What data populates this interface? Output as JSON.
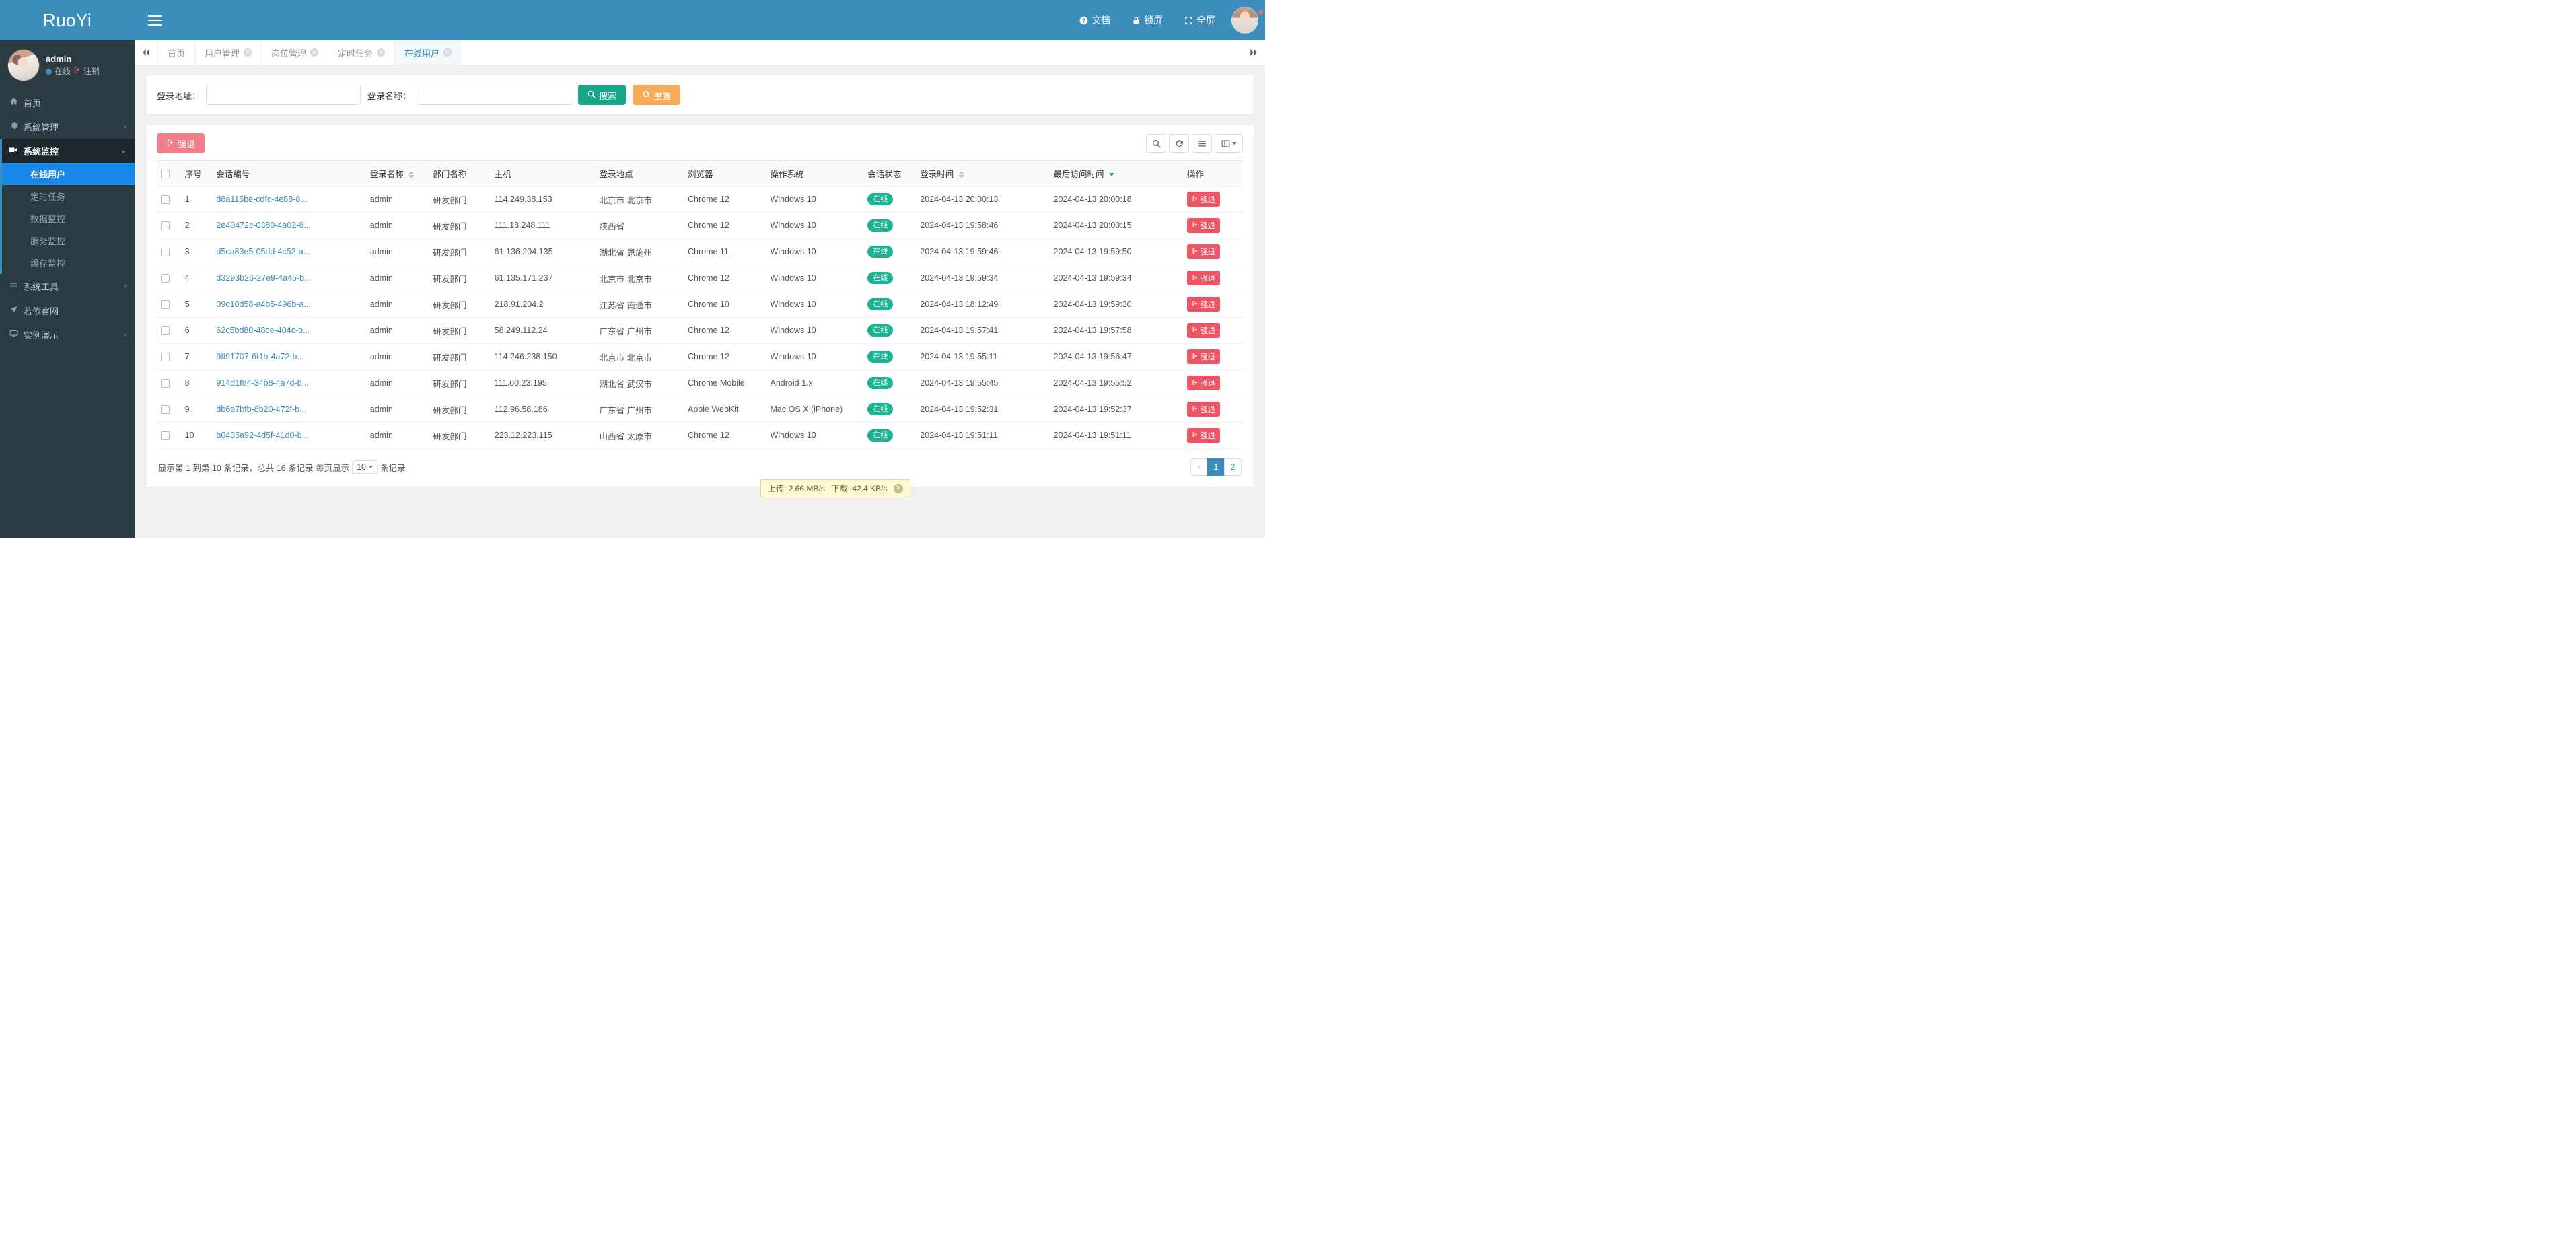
{
  "brand": {
    "title": "RuoYi"
  },
  "navbar": {
    "hamburger_icon": "hamburger-icon",
    "links": [
      {
        "label": "文档",
        "icon": "question-circle-icon",
        "name": "nav-docs"
      },
      {
        "label": "锁屏",
        "icon": "lock-icon",
        "name": "nav-lockscreen"
      },
      {
        "label": "全屏",
        "icon": "expand-arrows-icon",
        "name": "nav-fullscreen"
      }
    ]
  },
  "sidebar": {
    "user": {
      "name": "admin",
      "status": "在线",
      "logout": "注销"
    },
    "menu": [
      {
        "label": "首页",
        "icon": "home-icon",
        "arrow": "",
        "type": "link"
      },
      {
        "label": "系统管理",
        "icon": "gear-icon",
        "arrow": "‹",
        "type": "group"
      },
      {
        "label": "系统监控",
        "icon": "video-camera-icon",
        "arrow": "⌄",
        "type": "group",
        "open": true,
        "children": [
          {
            "label": "在线用户",
            "active": true
          },
          {
            "label": "定时任务",
            "active": false
          },
          {
            "label": "数据监控",
            "active": false
          },
          {
            "label": "服务监控",
            "active": false
          },
          {
            "label": "缓存监控",
            "active": false
          }
        ]
      },
      {
        "label": "系统工具",
        "icon": "bars-icon",
        "arrow": "‹",
        "type": "group"
      },
      {
        "label": "若依官网",
        "icon": "location-arrow-icon",
        "arrow": "",
        "type": "link"
      },
      {
        "label": "实例演示",
        "icon": "desktop-icon",
        "arrow": "‹",
        "type": "group"
      }
    ]
  },
  "tabs": {
    "collapse_icon": "double-chevron-left-icon",
    "more_icon": "double-chevron-right-icon",
    "items": [
      {
        "label": "首页",
        "closable": false,
        "active": false
      },
      {
        "label": "用户管理",
        "closable": true,
        "active": false
      },
      {
        "label": "岗位管理",
        "closable": true,
        "active": false
      },
      {
        "label": "定时任务",
        "closable": true,
        "active": false
      },
      {
        "label": "在线用户",
        "closable": true,
        "active": true
      }
    ]
  },
  "search": {
    "fields": [
      {
        "label": "登录地址：",
        "value": "",
        "placeholder": "",
        "name": "login-address-input"
      },
      {
        "label": "登录名称：",
        "value": "",
        "placeholder": "",
        "name": "login-name-input"
      }
    ],
    "search_button": "搜索",
    "search_icon": "search-icon",
    "reset_button": "重置",
    "reset_icon": "refresh-icon"
  },
  "toolbar": {
    "force_logout": "强退",
    "force_logout_icon": "sign-out-icon",
    "tools": [
      {
        "icon": "search-icon",
        "name": "table-search-button"
      },
      {
        "icon": "refresh-icon",
        "name": "table-refresh-button"
      },
      {
        "icon": "list-icon",
        "name": "table-view-toggle-button"
      },
      {
        "icon": "columns-icon",
        "name": "table-columns-button"
      }
    ]
  },
  "table": {
    "columns": [
      "序号",
      "会话编号",
      "登录名称",
      "部门名称",
      "主机",
      "登录地点",
      "浏览器",
      "操作系统",
      "会话状态",
      "登录时间",
      "最后访问时间",
      "操作"
    ],
    "sortable": {
      "登录名称": "none",
      "登录时间": "none",
      "最后访问时间": "desc"
    },
    "kick_label": "强退",
    "kick_icon": "sign-out-icon",
    "rows": [
      {
        "no": "1",
        "session": "d8a115be-cdfc-4e88-8...",
        "user": "admin",
        "dept": "研发部门",
        "host": "114.249.38.153",
        "location": "北京市 北京市",
        "browser": "Chrome 12",
        "os": "Windows 10",
        "status": "在线",
        "login_time": "2024-04-13 20:00:13",
        "last_time": "2024-04-13 20:00:18"
      },
      {
        "no": "2",
        "session": "2e40472c-0380-4a02-8...",
        "user": "admin",
        "dept": "研发部门",
        "host": "111.18.248.111",
        "location": "陕西省",
        "browser": "Chrome 12",
        "os": "Windows 10",
        "status": "在线",
        "login_time": "2024-04-13 19:58:46",
        "last_time": "2024-04-13 20:00:15"
      },
      {
        "no": "3",
        "session": "d5ca83e5-05dd-4c52-a...",
        "user": "admin",
        "dept": "研发部门",
        "host": "61.136.204.135",
        "location": "湖北省 恩施州",
        "browser": "Chrome 11",
        "os": "Windows 10",
        "status": "在线",
        "login_time": "2024-04-13 19:59:46",
        "last_time": "2024-04-13 19:59:50"
      },
      {
        "no": "4",
        "session": "d3293b26-27e9-4a45-b...",
        "user": "admin",
        "dept": "研发部门",
        "host": "61.135.171.237",
        "location": "北京市 北京市",
        "browser": "Chrome 12",
        "os": "Windows 10",
        "status": "在线",
        "login_time": "2024-04-13 19:59:34",
        "last_time": "2024-04-13 19:59:34"
      },
      {
        "no": "5",
        "session": "09c10d58-a4b5-496b-a...",
        "user": "admin",
        "dept": "研发部门",
        "host": "218.91.204.2",
        "location": "江苏省 南通市",
        "browser": "Chrome 10",
        "os": "Windows 10",
        "status": "在线",
        "login_time": "2024-04-13 18:12:49",
        "last_time": "2024-04-13 19:59:30"
      },
      {
        "no": "6",
        "session": "62c5bd80-48ce-404c-b...",
        "user": "admin",
        "dept": "研发部门",
        "host": "58.249.112.24",
        "location": "广东省 广州市",
        "browser": "Chrome 12",
        "os": "Windows 10",
        "status": "在线",
        "login_time": "2024-04-13 19:57:41",
        "last_time": "2024-04-13 19:57:58"
      },
      {
        "no": "7",
        "session": "9ff91707-6f1b-4a72-b...",
        "user": "admin",
        "dept": "研发部门",
        "host": "114.246.238.150",
        "location": "北京市 北京市",
        "browser": "Chrome 12",
        "os": "Windows 10",
        "status": "在线",
        "login_time": "2024-04-13 19:55:11",
        "last_time": "2024-04-13 19:56:47"
      },
      {
        "no": "8",
        "session": "914d1f84-34b8-4a7d-b...",
        "user": "admin",
        "dept": "研发部门",
        "host": "111.60.23.195",
        "location": "湖北省 武汉市",
        "browser": "Chrome Mobile",
        "os": "Android 1.x",
        "status": "在线",
        "login_time": "2024-04-13 19:55:45",
        "last_time": "2024-04-13 19:55:52"
      },
      {
        "no": "9",
        "session": "db6e7bfb-8b20-472f-b...",
        "user": "admin",
        "dept": "研发部门",
        "host": "112.96.58.186",
        "location": "广东省 广州市",
        "browser": "Apple WebKit",
        "os": "Mac OS X (iPhone)",
        "status": "在线",
        "login_time": "2024-04-13 19:52:31",
        "last_time": "2024-04-13 19:52:37"
      },
      {
        "no": "10",
        "session": "b0435a92-4d5f-41d0-b...",
        "user": "admin",
        "dept": "研发部门",
        "host": "223.12.223.115",
        "location": "山西省 太原市",
        "browser": "Chrome 12",
        "os": "Windows 10",
        "status": "在线",
        "login_time": "2024-04-13 19:51:11",
        "last_time": "2024-04-13 19:51:11"
      }
    ]
  },
  "footer": {
    "info_prefix": "显示第 1 到第 10 条记录，总共 16 条记录 每页显示",
    "page_size": "10",
    "info_suffix": "条记录",
    "pager": [
      {
        "label": "‹",
        "active": false,
        "disabled": true
      },
      {
        "label": "1",
        "active": true,
        "disabled": false
      },
      {
        "label": "2",
        "active": false,
        "disabled": false
      }
    ]
  },
  "net_indicator": {
    "upload": "上传: 2.66 MB/s",
    "download": "下载: 42.4 KB/s",
    "close_icon": "close-icon"
  }
}
